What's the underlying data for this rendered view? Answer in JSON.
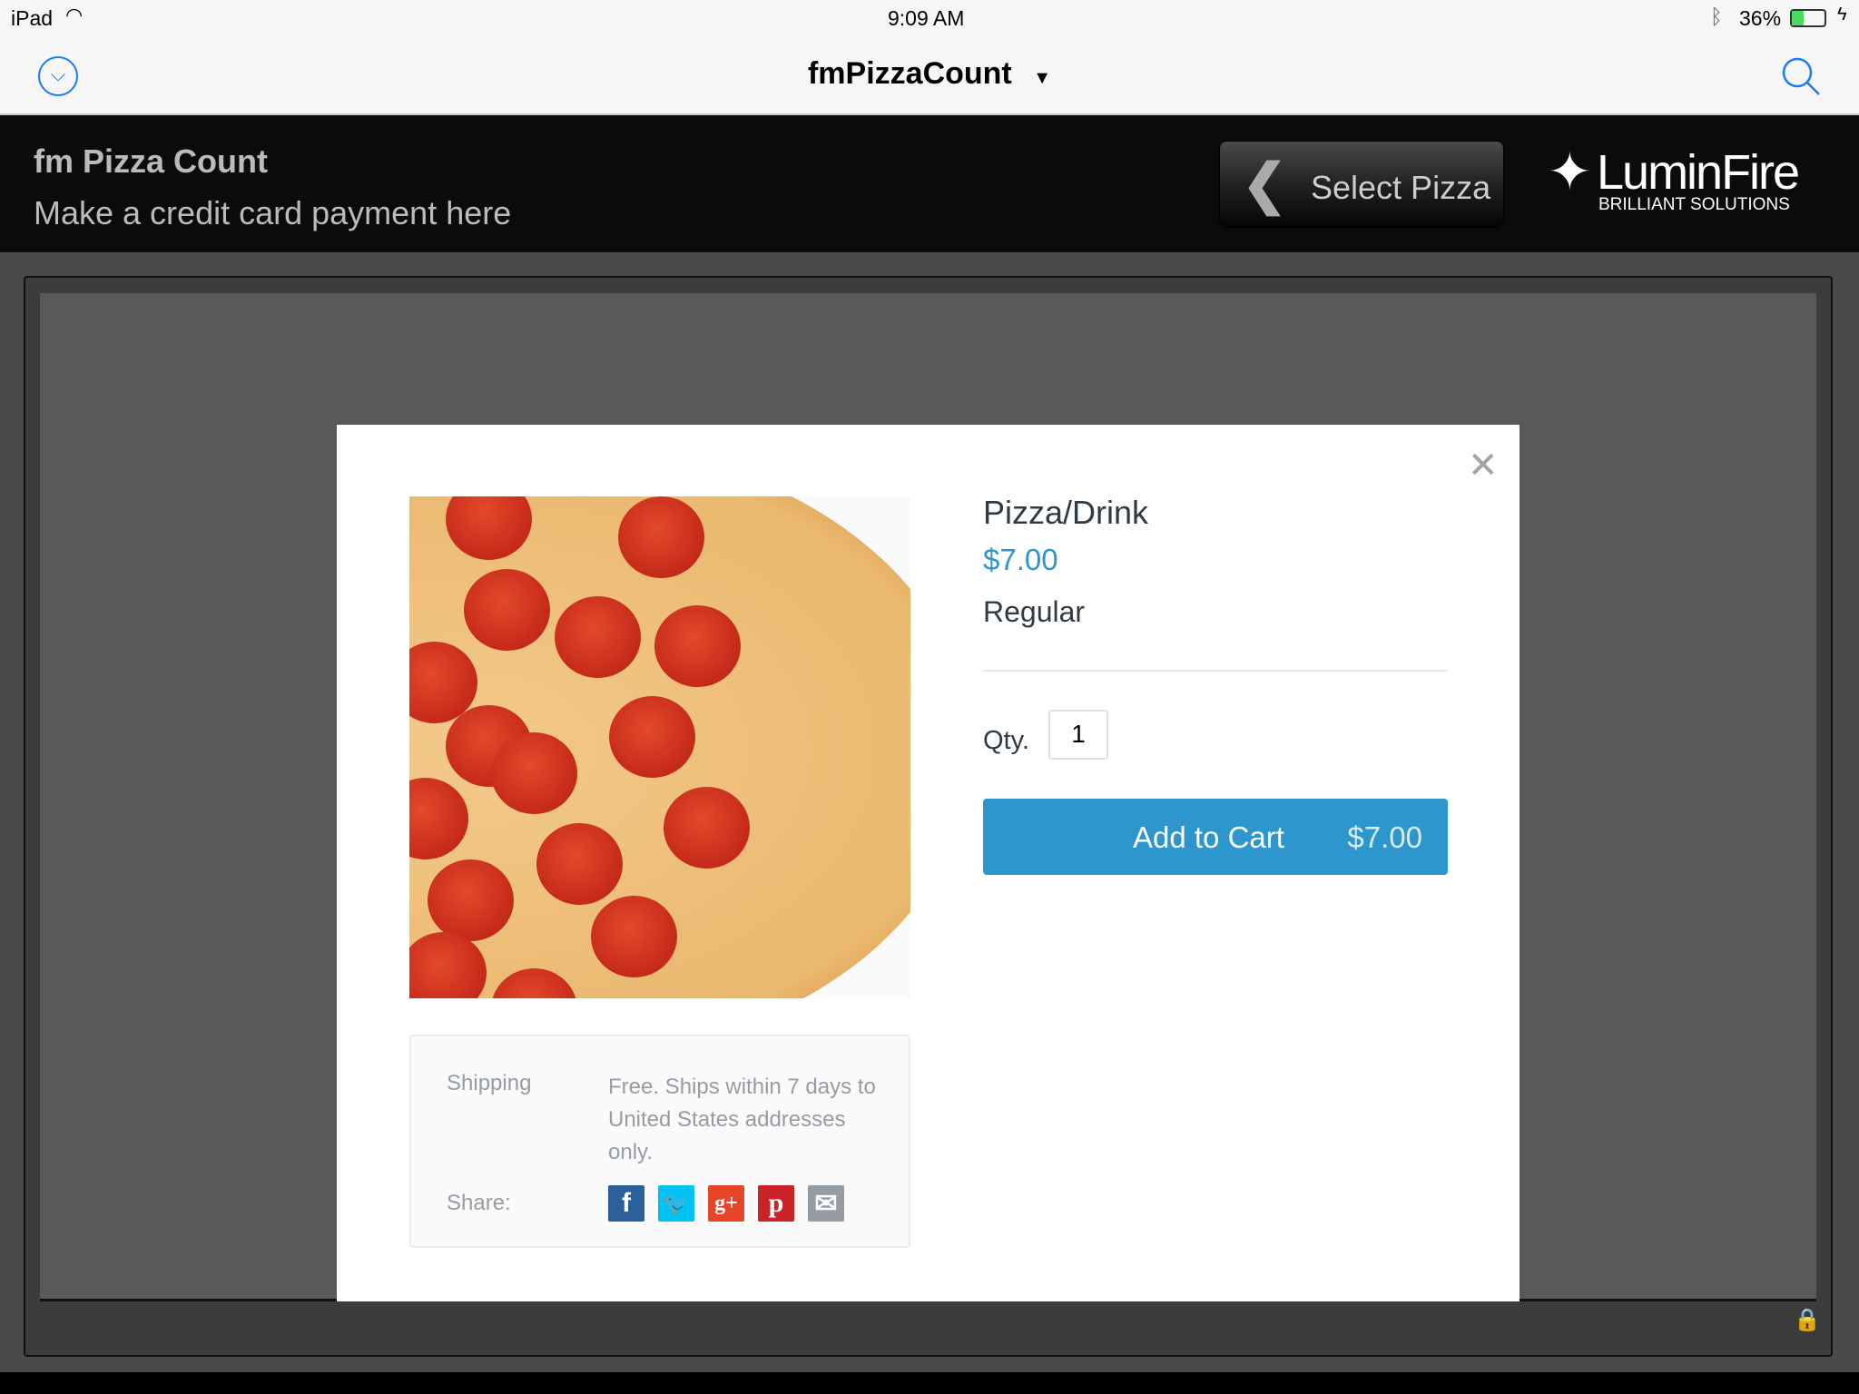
{
  "status_bar": {
    "device": "iPad",
    "time": "9:09 AM",
    "battery": "36%",
    "battery_level": 0.36,
    "battery_color": "#4cd964"
  },
  "nav": {
    "title": "fmPizzaCount",
    "dropdown_icon": "triangle-down-icon",
    "left_icon": "chevron-circle-down-icon",
    "right_icon": "search-icon",
    "accent": "#1a7cf5"
  },
  "header": {
    "title": "fm Pizza Count",
    "subtitle": "Make a credit card payment here",
    "back_button": "Select Pizza",
    "logo_name": "LuminFire",
    "logo_tagline": "BRILLIANT SOLUTIONS"
  },
  "product": {
    "name": "Pizza/Drink",
    "price": "$7.00",
    "variant": "Regular",
    "qty_label": "Qty.",
    "qty_value": "1",
    "add_to_cart": "Add to Cart",
    "cart_price": "$7.00",
    "accent": "#2d96cc"
  },
  "details": {
    "shipping_label": "Shipping",
    "shipping_text": "Free. Ships within 7 days to United States addresses only.",
    "share_label": "Share:",
    "share": [
      {
        "name": "facebook",
        "glyph": "f",
        "color": "#2d5f9a"
      },
      {
        "name": "twitter",
        "glyph": "🐦",
        "color": "#00c3f3"
      },
      {
        "name": "google-plus",
        "glyph": "g+",
        "color": "#e8442a"
      },
      {
        "name": "pinterest",
        "glyph": "p",
        "color": "#cb2128"
      },
      {
        "name": "email",
        "glyph": "✉",
        "color": "#959ca4"
      }
    ]
  }
}
